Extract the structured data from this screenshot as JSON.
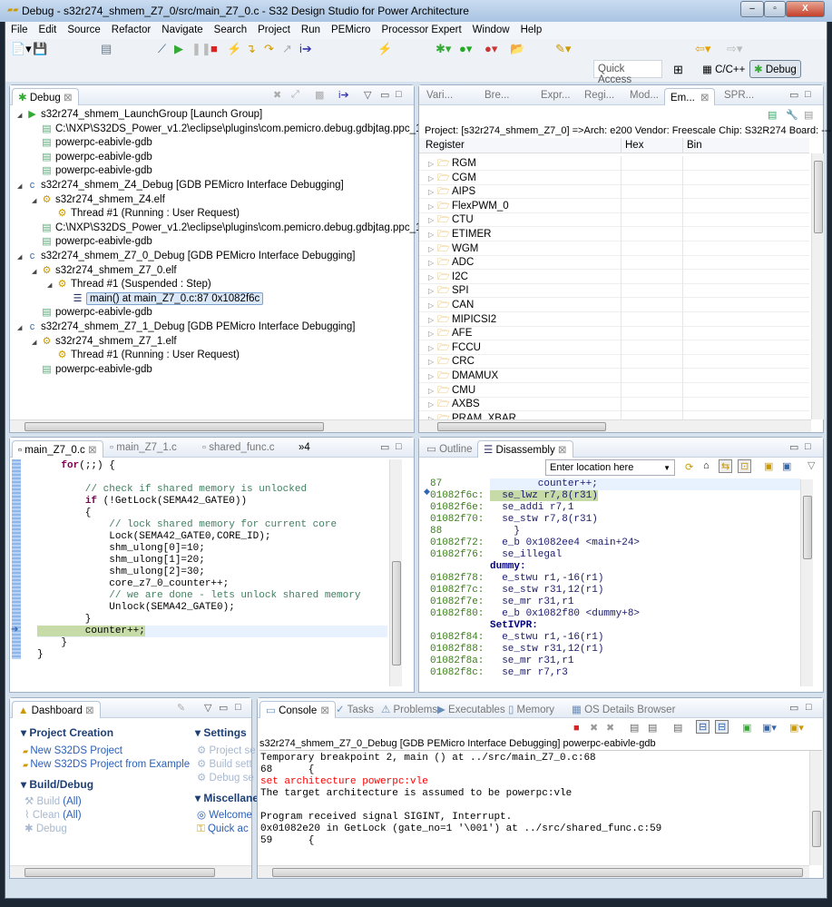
{
  "window": {
    "title": "Debug - s32r274_shmem_Z7_0/src/main_Z7_0.c - S32 Design Studio for Power Architecture",
    "minimize": "–",
    "maximize": "▫",
    "close": "X"
  },
  "menu": [
    "File",
    "Edit",
    "Source",
    "Refactor",
    "Navigate",
    "Search",
    "Project",
    "Run",
    "PEMicro",
    "Processor Expert",
    "Window",
    "Help"
  ],
  "toolbar": {
    "quick_access": "Quick Access",
    "perspectives": [
      "C/C++",
      "Debug"
    ],
    "active_perspective": "Debug"
  },
  "debug_view": {
    "tab": "Debug",
    "tree": [
      {
        "level": 0,
        "icon": "launch-group",
        "text": "s32r274_shmem_LaunchGroup [Launch Group]",
        "toggle": "◢"
      },
      {
        "level": 1,
        "icon": "process",
        "text": "C:\\NXP\\S32DS_Power_v1.2\\eclipse\\plugins\\com.pemicro.debug.gdbjtag.ppc_1.6.9.20"
      },
      {
        "level": 1,
        "icon": "process",
        "text": "powerpc-eabivle-gdb"
      },
      {
        "level": 1,
        "icon": "process",
        "text": "powerpc-eabivle-gdb"
      },
      {
        "level": 1,
        "icon": "process",
        "text": "powerpc-eabivle-gdb"
      },
      {
        "level": 0,
        "icon": "c-launch",
        "text": "s32r274_shmem_Z4_Debug [GDB PEMicro Interface Debugging]",
        "toggle": "◢"
      },
      {
        "level": 1,
        "icon": "elf",
        "text": "s32r274_shmem_Z4.elf",
        "toggle": "◢"
      },
      {
        "level": 2,
        "icon": "thread-running",
        "text": "Thread #1 (Running : User Request)"
      },
      {
        "level": 1,
        "icon": "process",
        "text": "C:\\NXP\\S32DS_Power_v1.2\\eclipse\\plugins\\com.pemicro.debug.gdbjtag.ppc_1.6.9.20"
      },
      {
        "level": 1,
        "icon": "process",
        "text": "powerpc-eabivle-gdb"
      },
      {
        "level": 0,
        "icon": "c-launch",
        "text": "s32r274_shmem_Z7_0_Debug [GDB PEMicro Interface Debugging]",
        "toggle": "◢"
      },
      {
        "level": 1,
        "icon": "elf",
        "text": "s32r274_shmem_Z7_0.elf",
        "toggle": "◢"
      },
      {
        "level": 2,
        "icon": "thread-suspended",
        "text": "Thread #1 (Suspended : Step)",
        "toggle": "◢"
      },
      {
        "level": 3,
        "icon": "stack-frame",
        "text": "main() at main_Z7_0.c:87 0x1082f6c",
        "selected": true
      },
      {
        "level": 1,
        "icon": "process",
        "text": "powerpc-eabivle-gdb"
      },
      {
        "level": 0,
        "icon": "c-launch",
        "text": "s32r274_shmem_Z7_1_Debug [GDB PEMicro Interface Debugging]",
        "toggle": "◢"
      },
      {
        "level": 1,
        "icon": "elf",
        "text": "s32r274_shmem_Z7_1.elf",
        "toggle": "◢"
      },
      {
        "level": 2,
        "icon": "thread-running",
        "text": "Thread #1 (Running : User Request)"
      },
      {
        "level": 1,
        "icon": "process",
        "text": "powerpc-eabivle-gdb"
      }
    ]
  },
  "register_view": {
    "tabs": [
      "Vari...",
      "Bre...",
      "Expr...",
      "Regi...",
      "Mod...",
      "Em...",
      "SPR..."
    ],
    "active_tab": "Em...",
    "info": "Project: [s32r274_shmem_Z7_0] =>Arch: e200  Vendor: Freescale  Chip: S32R274  Board: ---  none",
    "columns": [
      "Register",
      "Hex",
      "Bin"
    ],
    "rows": [
      "RGM",
      "CGM",
      "AIPS",
      "FlexPWM_0",
      "CTU",
      "ETIMER",
      "WGM",
      "ADC",
      "I2C",
      "SPI",
      "CAN",
      "MIPICSI2",
      "AFE",
      "FCCU",
      "CRC",
      "DMAMUX",
      "CMU",
      "AXBS",
      "PRAM_XBAR"
    ]
  },
  "editor": {
    "tabs": [
      "main_Z7_0.c",
      "main_Z7_1.c",
      "shared_func.c"
    ],
    "overflow": "»4",
    "lines": [
      {
        "t": "    for(;;) {",
        "k": "for"
      },
      {
        "t": ""
      },
      {
        "t": "        // check if shared memory is unlocked",
        "c": true
      },
      {
        "t": "        if (!GetLock(SEMA42_GATE0))",
        "k": "if"
      },
      {
        "t": "        {"
      },
      {
        "t": "            // lock shared memory for current core",
        "c": true
      },
      {
        "t": "            Lock(SEMA42_GATE0,CORE_ID);"
      },
      {
        "t": "            shm_ulong[0]=10;"
      },
      {
        "t": "            shm_ulong[1]=20;"
      },
      {
        "t": "            shm_ulong[2]=30;"
      },
      {
        "t": "            core_z7_0_counter++;"
      },
      {
        "t": "            // we are done - lets unlock shared memory",
        "c": true
      },
      {
        "t": "            Unlock(SEMA42_GATE0);"
      },
      {
        "t": "        }"
      },
      {
        "t": "        counter++;",
        "current": true
      },
      {
        "t": "    }"
      },
      {
        "t": "}"
      }
    ]
  },
  "disassembly": {
    "tabs": [
      "Outline",
      "Disassembly"
    ],
    "location_placeholder": "Enter location here",
    "lines": [
      {
        "a": "87",
        "i": "        counter++;",
        "src": true
      },
      {
        "a": "01082f6c:",
        "i": "  se_lwz r7,8(r31)",
        "current": true
      },
      {
        "a": "01082f6e:",
        "i": "  se_addi r7,1"
      },
      {
        "a": "01082f70:",
        "i": "  se_stw r7,8(r31)"
      },
      {
        "a": "88",
        "i": "    }"
      },
      {
        "a": "01082f72:",
        "i": "  e_b 0x1082ee4 <main+24>"
      },
      {
        "a": "01082f76:",
        "i": "  se_illegal"
      },
      {
        "a": "",
        "i": "dummy:",
        "label": true
      },
      {
        "a": "01082f78:",
        "i": "  e_stwu r1,-16(r1)"
      },
      {
        "a": "01082f7c:",
        "i": "  se_stw r31,12(r1)"
      },
      {
        "a": "01082f7e:",
        "i": "  se_mr r31,r1"
      },
      {
        "a": "01082f80:",
        "i": "  e_b 0x1082f80 <dummy+8>"
      },
      {
        "a": "",
        "i": "SetIVPR:",
        "label": true
      },
      {
        "a": "01082f84:",
        "i": "  e_stwu r1,-16(r1)"
      },
      {
        "a": "01082f88:",
        "i": "  se_stw r31,12(r1)"
      },
      {
        "a": "01082f8a:",
        "i": "  se_mr r31,r1"
      },
      {
        "a": "01082f8c:",
        "i": "  se_mr r7,r3"
      }
    ]
  },
  "dashboard": {
    "tab": "Dashboard",
    "project_creation": {
      "title": "Project Creation",
      "items": [
        "New S32DS Project",
        "New S32DS Project from Example"
      ]
    },
    "build_debug": {
      "title": "Build/Debug",
      "build": "Build",
      "clean": "Clean",
      "all": "(All)",
      "debug": "Debug"
    },
    "settings": {
      "title": "Settings",
      "items": [
        "Project se",
        "Build sett",
        "Debug se"
      ]
    },
    "misc": {
      "title": "Miscellane",
      "items": [
        "Welcome",
        "Quick ac"
      ]
    }
  },
  "console": {
    "tabs": [
      "Console",
      "Tasks",
      "Problems",
      "Executables",
      "Memory",
      "OS Details Browser"
    ],
    "header": "s32r274_shmem_Z7_0_Debug [GDB PEMicro Interface Debugging] powerpc-eabivle-gdb",
    "lines": [
      {
        "t": "Temporary breakpoint 2, main () at ../src/main_Z7_0.c:68"
      },
      {
        "t": "68      {"
      },
      {
        "t": "set architecture powerpc:vle",
        "err": true
      },
      {
        "t": "The target architecture is assumed to be powerpc:vle"
      },
      {
        "t": ""
      },
      {
        "t": "Program received signal SIGINT, Interrupt."
      },
      {
        "t": "0x01082e20 in GetLock (gate_no=1 '\\001') at ../src/shared_func.c:59"
      },
      {
        "t": "59      {"
      }
    ]
  },
  "colors": {
    "current_line": "#c6dba8",
    "error_text": "#ff0000",
    "address": "#3a7e1a",
    "link": "#2b5fb4"
  }
}
